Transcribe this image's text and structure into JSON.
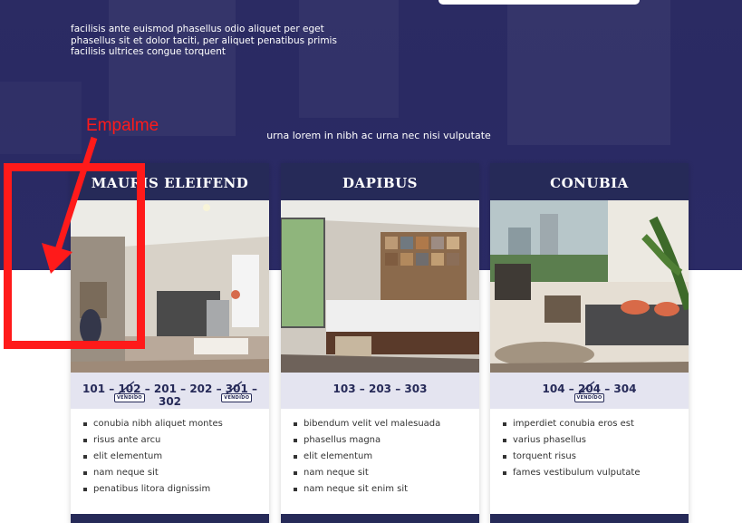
{
  "hero": {
    "intro_text": "facilisis ante euismod phasellus odio aliquet per eget phasellus sit et dolor taciti, per aliquet penatibus primis facilisis ultrices congue torquent",
    "subtitle": "urna lorem in nibh ac urna nec nisi vulputate"
  },
  "annotation": {
    "label": "Empalme",
    "color": "#ff1a1a"
  },
  "colors": {
    "brand_navy": "#262a58",
    "units_band": "#e4e4f0"
  },
  "sold_label": "VENDIDO",
  "cards": [
    {
      "title": "MAURIS ELEIFEND",
      "units": [
        "101",
        "102",
        "201",
        "202",
        "301",
        "302"
      ],
      "sold_units": [
        "102",
        "301"
      ],
      "features": [
        "conubia nibh aliquet montes",
        "risus ante arcu",
        "elit elementum",
        "nam neque sit",
        "penatibus litora dignissim"
      ]
    },
    {
      "title": "DAPIBUS",
      "units": [
        "103",
        "203",
        "303"
      ],
      "sold_units": [],
      "features": [
        "bibendum velit vel malesuada",
        "phasellus magna",
        "elit elementum",
        "nam neque sit",
        "nam neque sit enim sit"
      ]
    },
    {
      "title": "CONUBIA",
      "units": [
        "104",
        "204",
        "304"
      ],
      "sold_units": [
        "204"
      ],
      "features": [
        "imperdiet conubia eros est",
        "varius phasellus",
        "torquent risus",
        "fames vestibulum vulputate"
      ]
    }
  ]
}
